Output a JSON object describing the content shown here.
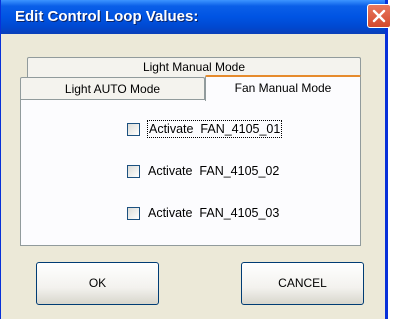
{
  "window": {
    "title": "Edit Control Loop Values:"
  },
  "tabs": {
    "back_row": [
      "Light Manual Mode"
    ],
    "front_row": [
      "Light AUTO Mode",
      "Fan Manual Mode"
    ],
    "active": "Fan Manual Mode"
  },
  "panel": {
    "checkboxes": [
      {
        "label": "Activate  FAN_4105_01",
        "checked": false
      },
      {
        "label": "Activate  FAN_4105_02",
        "checked": false
      },
      {
        "label": "Activate  FAN_4105_03",
        "checked": false
      }
    ]
  },
  "buttons": {
    "ok_label": "OK",
    "cancel_label": "CANCEL"
  },
  "colors": {
    "titlebar": "#0054e3",
    "dialog_bg": "#ece9d8",
    "active_tab_highlight": "#e68b2c",
    "close_button": "#d4482c"
  }
}
